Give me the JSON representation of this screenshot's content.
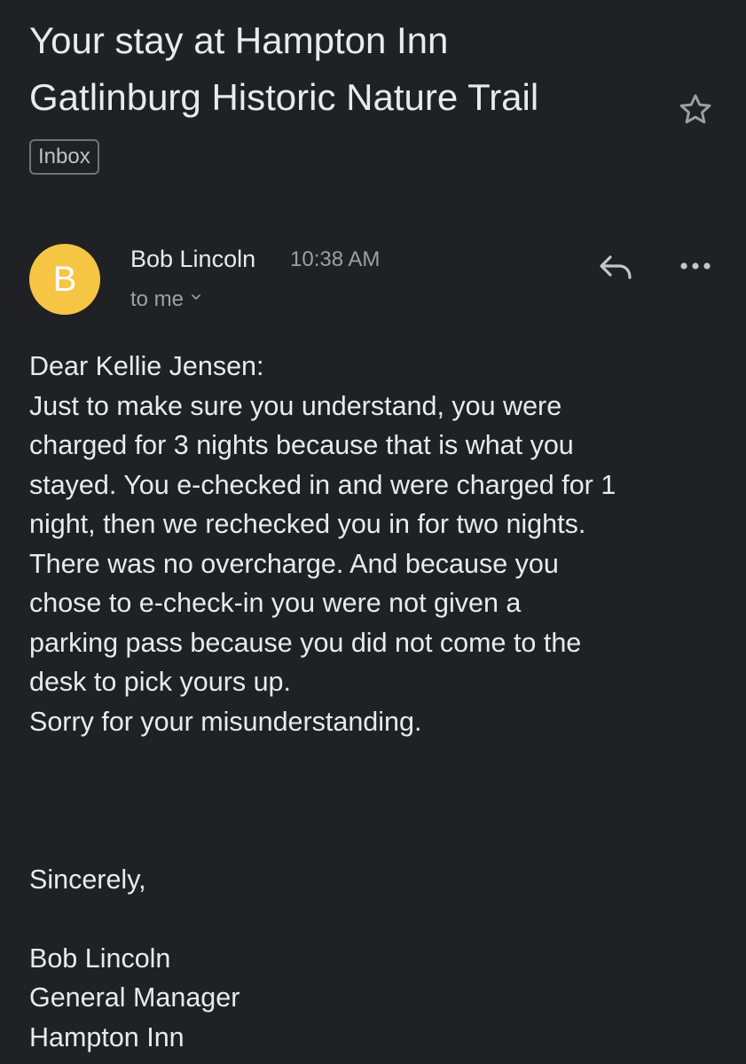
{
  "email": {
    "subject_lines": [
      "Your stay at Hampton Inn",
      "Gatlinburg Historic Nature Trail"
    ],
    "label": "Inbox",
    "sender": {
      "avatar_letter": "B",
      "avatar_color": "#f6c544",
      "name": "Bob Lincoln",
      "time": "10:38 AM",
      "recipient": "to me"
    },
    "icons": {
      "star": "star-icon",
      "reply": "reply-icon",
      "more": "more-options-icon",
      "recipient_details": "chevron-down-icon"
    },
    "body": {
      "greeting": "Dear Kellie Jensen:",
      "paragraph_lines": [
        "Just to make sure you understand, you were",
        "charged for 3 nights because that is what you",
        "stayed. You e-checked in and were charged for 1",
        "night, then we rechecked you in for two nights.",
        "There was no overcharge. And because you",
        "chose to e-check-in you were not given a",
        "parking pass because you did not come to the",
        "desk to pick yours up.",
        "Sorry for your misunderstanding."
      ],
      "closing": "Sincerely,",
      "signature_lines": [
        "Bob Lincoln",
        "General Manager",
        "Hampton Inn"
      ]
    }
  },
  "colors": {
    "background": "#202124",
    "primary_text": "#e8eaed",
    "secondary_text": "#9aa0a6"
  }
}
